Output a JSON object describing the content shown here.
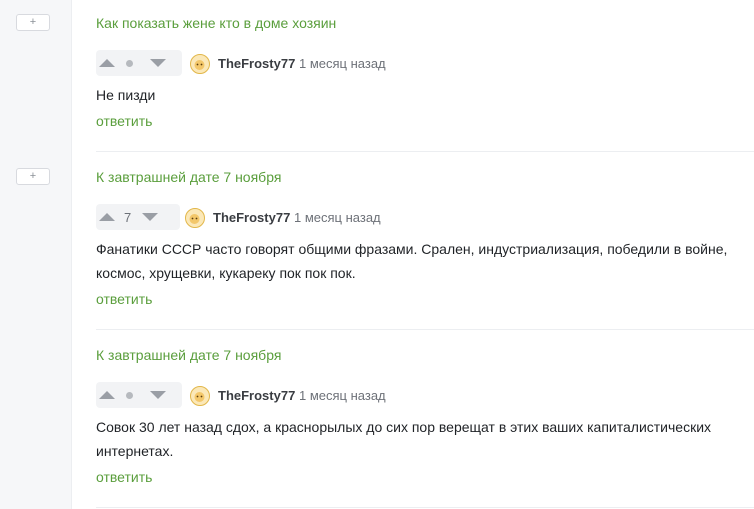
{
  "expand_label": "+",
  "reply_label": "ответить",
  "comments": [
    {
      "post_title": "Как показать жене кто в доме хозяин",
      "score": "",
      "author": "TheFrosty77",
      "time": "1 месяц назад",
      "text": "Не пизди"
    },
    {
      "post_title": "К завтрашней дате 7 ноября",
      "score": "7",
      "author": "TheFrosty77",
      "time": "1 месяц назад",
      "text": "Фанатики СССР часто говорят общими фразами. Срален, индустриализация, победили в войне, космос, хрущевки, кукареку пок пок пок."
    },
    {
      "post_title": "К завтрашней дате 7 ноября",
      "score": "",
      "author": "TheFrosty77",
      "time": "1 месяц назад",
      "text": "Совок 30 лет назад сдох, а краснорылых до сих пор верещат в этих ваших капиталистических интернетах."
    }
  ],
  "colors": {
    "link": "#5a9e3c",
    "rail": "#f6f7f9"
  }
}
